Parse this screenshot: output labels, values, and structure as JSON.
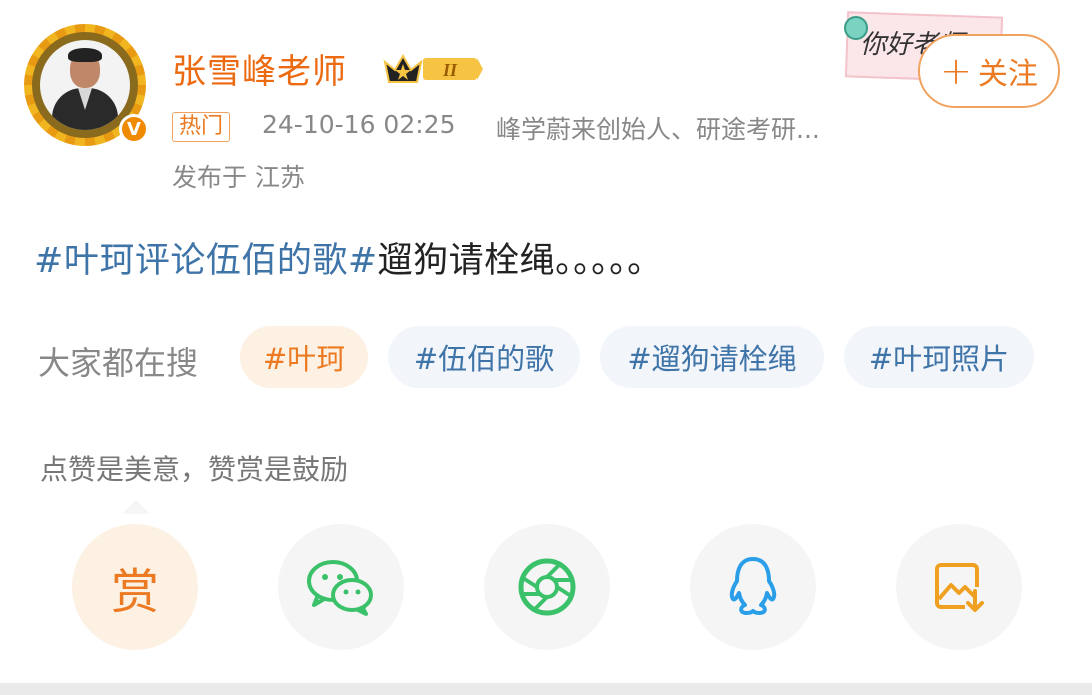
{
  "user": {
    "name": "张雪峰老师",
    "level_badge": "II",
    "verified_mark": "V"
  },
  "post_meta": {
    "tag": "热门",
    "time": "24-10-16 02:25",
    "description": "峰学蔚来创始人、研途考研...",
    "location": "发布于 江苏"
  },
  "sticker": {
    "text": "你好老师"
  },
  "follow_button": {
    "plus": "+",
    "label": "关注"
  },
  "post": {
    "topic": "#叶珂评论伍佰的歌#",
    "text": "遛狗请栓绳。。。。。"
  },
  "search_section": {
    "label": "大家都在搜",
    "chips": [
      "#叶珂",
      "#伍佰的歌",
      "#遛狗请栓绳",
      "#叶珂照片"
    ]
  },
  "reward_tip": "点赞是美意，赞赏是鼓励",
  "actions": {
    "reward_label": "赏",
    "icons": [
      "reward-icon",
      "wechat-icon",
      "moments-icon",
      "qq-icon",
      "save-image-icon"
    ]
  },
  "colors": {
    "accent_orange": "#ec7a22",
    "topic_blue": "#3f74a8",
    "wechat_green": "#3cc16b",
    "qq_blue": "#2a9ee8"
  }
}
